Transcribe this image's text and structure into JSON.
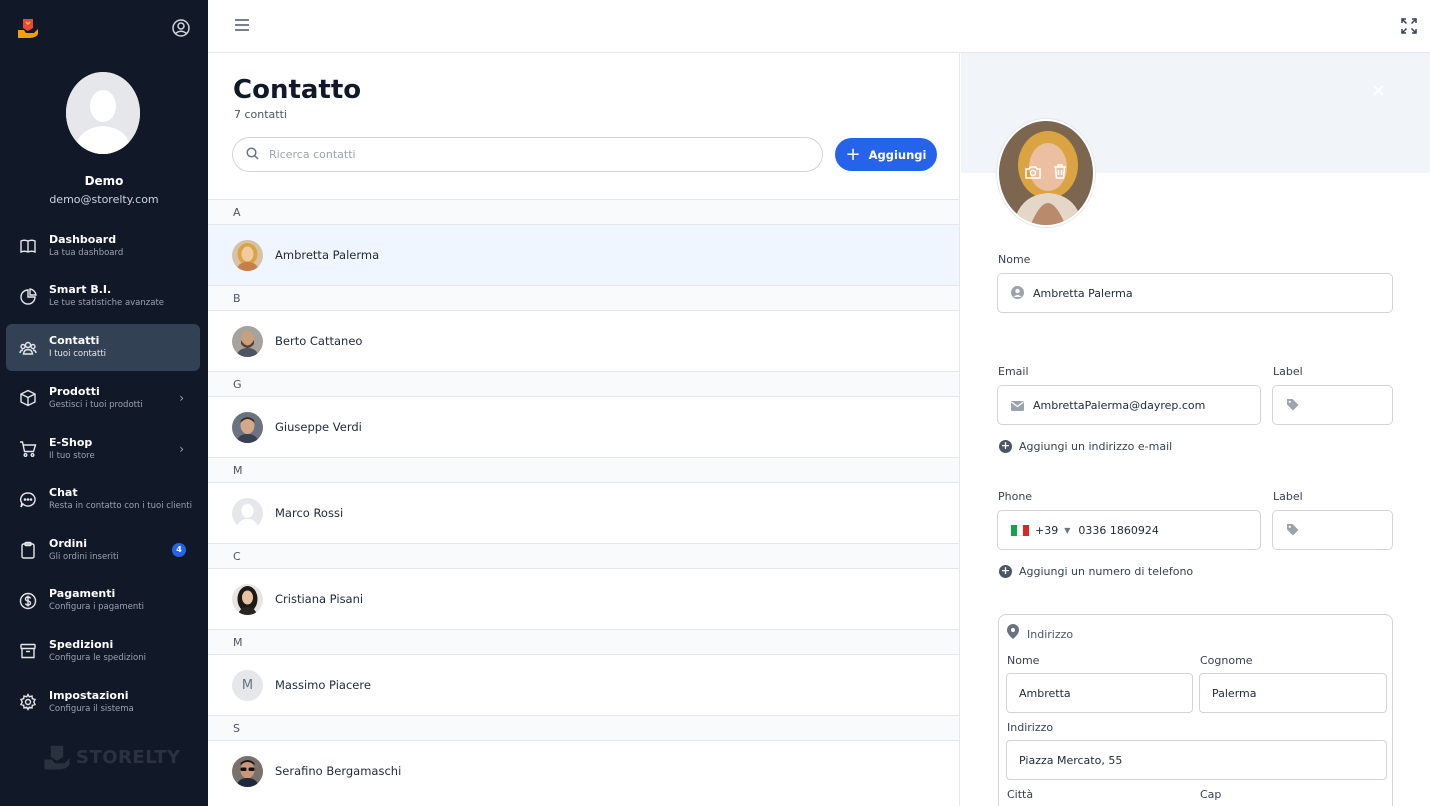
{
  "sidebar": {
    "user_name": "Demo",
    "user_email": "demo@storelty.com",
    "brand": "STORELTY",
    "items": [
      {
        "icon": "book-icon",
        "title": "Dashboard",
        "subtitle": "La tua dashboard"
      },
      {
        "icon": "pie-chart-icon",
        "title": "Smart B.I.",
        "subtitle": "Le tue statistiche avanzate"
      },
      {
        "icon": "users-icon",
        "title": "Contatti",
        "subtitle": "I tuoi contatti",
        "active": true
      },
      {
        "icon": "cube-icon",
        "title": "Prodotti",
        "subtitle": "Gestisci i tuoi prodotti",
        "chevron": true
      },
      {
        "icon": "cart-icon",
        "title": "E-Shop",
        "subtitle": "Il tuo store",
        "chevron": true
      },
      {
        "icon": "chat-icon",
        "title": "Chat",
        "subtitle": "Resta in contatto con i tuoi clienti"
      },
      {
        "icon": "clipboard-icon",
        "title": "Ordini",
        "subtitle": "Gli ordini inseriti",
        "badge": "4"
      },
      {
        "icon": "dollar-icon",
        "title": "Pagamenti",
        "subtitle": "Configura i pagamenti"
      },
      {
        "icon": "archive-icon",
        "title": "Spedizioni",
        "subtitle": "Configura le spedizioni"
      },
      {
        "icon": "gear-icon",
        "title": "Impostazioni",
        "subtitle": "Configura il sistema"
      }
    ]
  },
  "list": {
    "title": "Contatto",
    "count": "7 contatti",
    "search_placeholder": "Ricerca contatti",
    "add_label": "Aggiungi",
    "groups": [
      {
        "letter": "A",
        "name": "Ambretta Palerma",
        "avatar": "photo-woman-blonde",
        "selected": true
      },
      {
        "letter": "B",
        "name": "Berto Cattaneo",
        "avatar": "photo-man-beard"
      },
      {
        "letter": "G",
        "name": "Giuseppe Verdi",
        "avatar": "photo-man-smile"
      },
      {
        "letter": "M",
        "name": "Marco Rossi",
        "avatar": "placeholder"
      },
      {
        "letter": "C",
        "name": "Cristiana Pisani",
        "avatar": "photo-woman-dark"
      },
      {
        "letter": "M",
        "name": "Massimo Piacere",
        "avatar": "initial",
        "initial": "M"
      },
      {
        "letter": "S",
        "name": "Serafino Bergamaschi",
        "avatar": "photo-man-sunglasses"
      }
    ]
  },
  "detail": {
    "nome_label": "Nome",
    "nome_value": "Ambretta Palerma",
    "email_label": "Email",
    "email_value": "AmbrettaPalerma@dayrep.com",
    "label_label": "Label",
    "add_email": "Aggiungi un indirizzo e-mail",
    "phone_label": "Phone",
    "phone_prefix": "+39",
    "phone_value": "0336 1860924",
    "add_phone": "Aggiungi un numero di telefono",
    "address_title": "Indirizzo",
    "addr_nome_label": "Nome",
    "addr_nome_value": "Ambretta",
    "addr_cognome_label": "Cognome",
    "addr_cognome_value": "Palerma",
    "addr_indirizzo_label": "Indirizzo",
    "addr_indirizzo_value": "Piazza Mercato, 55",
    "addr_citta_label": "Città",
    "addr_cap_label": "Cap"
  },
  "colors": {
    "sidebar_bg": "#111827",
    "accent": "#2563eb",
    "active_item": "#334155"
  }
}
